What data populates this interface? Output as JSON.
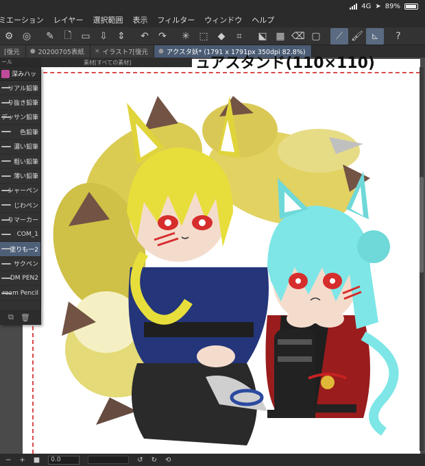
{
  "status": {
    "network": "4G",
    "battery": "89%"
  },
  "menu": [
    "ミエーション",
    "レイヤー",
    "選択範囲",
    "表示",
    "フィルター",
    "ウィンドウ",
    "ヘルプ"
  ],
  "toolbar": [
    "settings-sliders-icon",
    "layers-circle-icon",
    "pen-icon",
    "new-file-icon",
    "open-folder-icon",
    "export-icon",
    "arrows-updown-icon",
    "undo-icon",
    "redo-icon",
    "loading-spin-icon",
    "transform-icon",
    "fill-icon",
    "crop-icon",
    "hide-selection-icon",
    "checker-icon",
    "eraser-icon",
    "frame-icon",
    "pen-pressure-icon",
    "brush-stroke-icon",
    "ruler-icon",
    "help-icon"
  ],
  "tabs": [
    {
      "label": "[復元",
      "active": false
    },
    {
      "label": "20200705表紙",
      "active": false
    },
    {
      "label": "イラスト7[復元",
      "active": false
    },
    {
      "label": "アクスタ妖* (1791 x 1791px 350dpi 82.8%)",
      "active": true
    }
  ],
  "subheader": {
    "left": "ール",
    "material": "素材[すべての素材]"
  },
  "canvas": {
    "title": "ュアスタンド(110×110)"
  },
  "brush_panel": {
    "header": "深みハッ",
    "items": [
      "リアル鉛筆",
      "り抜き鉛筆",
      "デッサン鉛筆",
      "色鉛筆",
      "濃い鉛筆",
      "粗い鉛筆",
      "薄い鉛筆",
      "シャーペン",
      "じわペン",
      "りマーカー",
      "COM_1",
      "塗りも一2",
      "サクペン",
      "DM PEN2",
      "ream Pencil"
    ],
    "selected_index": 11
  },
  "bottom": {
    "zoom": "0.0"
  }
}
